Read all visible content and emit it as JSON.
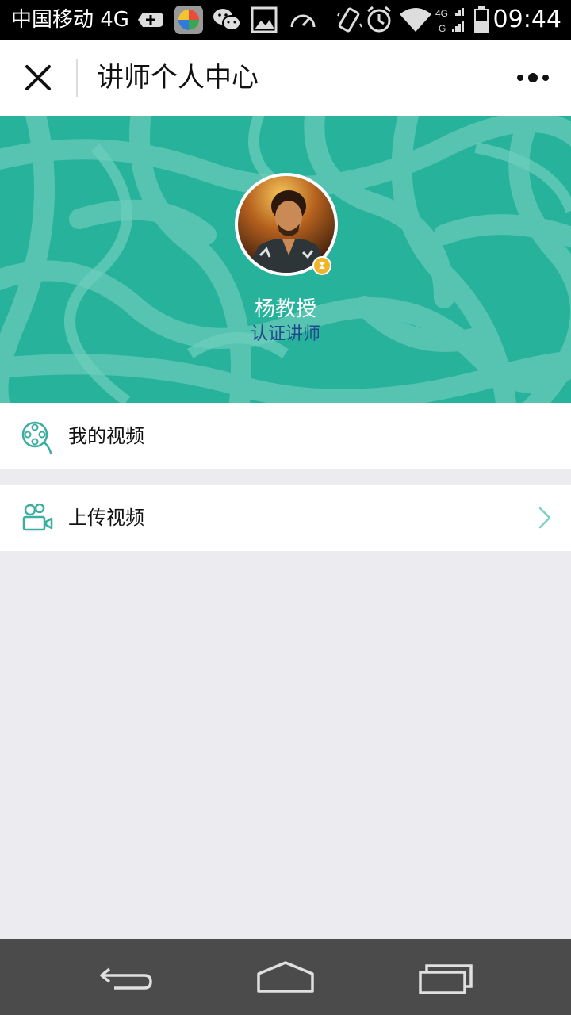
{
  "status_bar": {
    "carrier": "中国移动 4G",
    "time": "09:44",
    "network_badge_top": "4G",
    "network_badge_bottom": "G"
  },
  "navbar": {
    "title": "讲师个人中心",
    "close_icon": "close-icon",
    "more_icon": "more-dots-icon"
  },
  "profile": {
    "name": "杨教授",
    "role": "认证讲师",
    "badge_icon": "verified-badge-icon"
  },
  "menu": [
    {
      "label": "我的视频",
      "icon": "film-reel-icon",
      "has_arrow": false
    },
    {
      "label": "上传视频",
      "icon": "video-camera-icon",
      "has_arrow": true
    }
  ],
  "colors": {
    "accent": "#27b29c",
    "icon_teal": "#3aaea0",
    "badge": "#f0b52b",
    "role_text": "#1f4a8c",
    "background": "#ebebf0"
  }
}
